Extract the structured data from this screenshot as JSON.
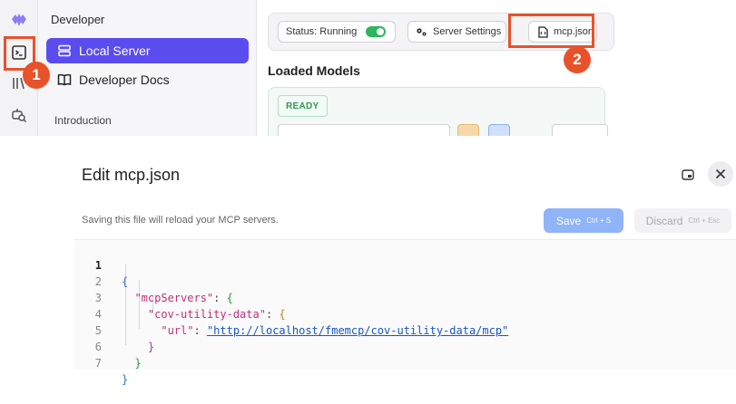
{
  "sidebar": {
    "section_title": "Developer",
    "items": [
      {
        "label": "Local Server",
        "icon": "server-icon",
        "active": true
      },
      {
        "label": "Developer Docs",
        "icon": "book-icon",
        "active": false
      }
    ],
    "footer_item": "Introduction"
  },
  "rail": {
    "icons": [
      "app-logo-icon",
      "terminal-icon",
      "library-icon",
      "model-search-icon"
    ]
  },
  "status_bar": {
    "status_label": "Status: Running",
    "status_on": true,
    "server_settings_label": "Server Settings",
    "mcp_json_label": "mcp.json"
  },
  "loaded_models": {
    "title": "Loaded Models",
    "badge": "READY"
  },
  "callouts": [
    "1",
    "2"
  ],
  "dialog": {
    "title": "Edit mcp.json",
    "subtitle": "Saving this file will reload your MCP servers.",
    "save_label": "Save",
    "save_shortcut": "Ctrl + S",
    "discard_label": "Discard",
    "discard_shortcut": "Ctrl + Esc"
  },
  "editor": {
    "line_numbers": [
      "1",
      "2",
      "3",
      "4",
      "5",
      "6",
      "7"
    ],
    "current_line": 1,
    "tokens": {
      "open_root": "{",
      "mcp_servers_key": "\"mcpServers\"",
      "colon": ":",
      "open_servers": "{",
      "server_key": "\"cov-utility-data\"",
      "open_server": "{",
      "url_key": "\"url\"",
      "url_value": "\"http://localhost/fmemcp/cov-utility-data/mcp\"",
      "close_server": "}",
      "close_servers": "}",
      "close_root": "}"
    }
  },
  "colors": {
    "accent": "#5b4cf0",
    "highlight": "#e8522b",
    "running_green": "#2db55d",
    "save_blue": "#8fb4f8"
  }
}
